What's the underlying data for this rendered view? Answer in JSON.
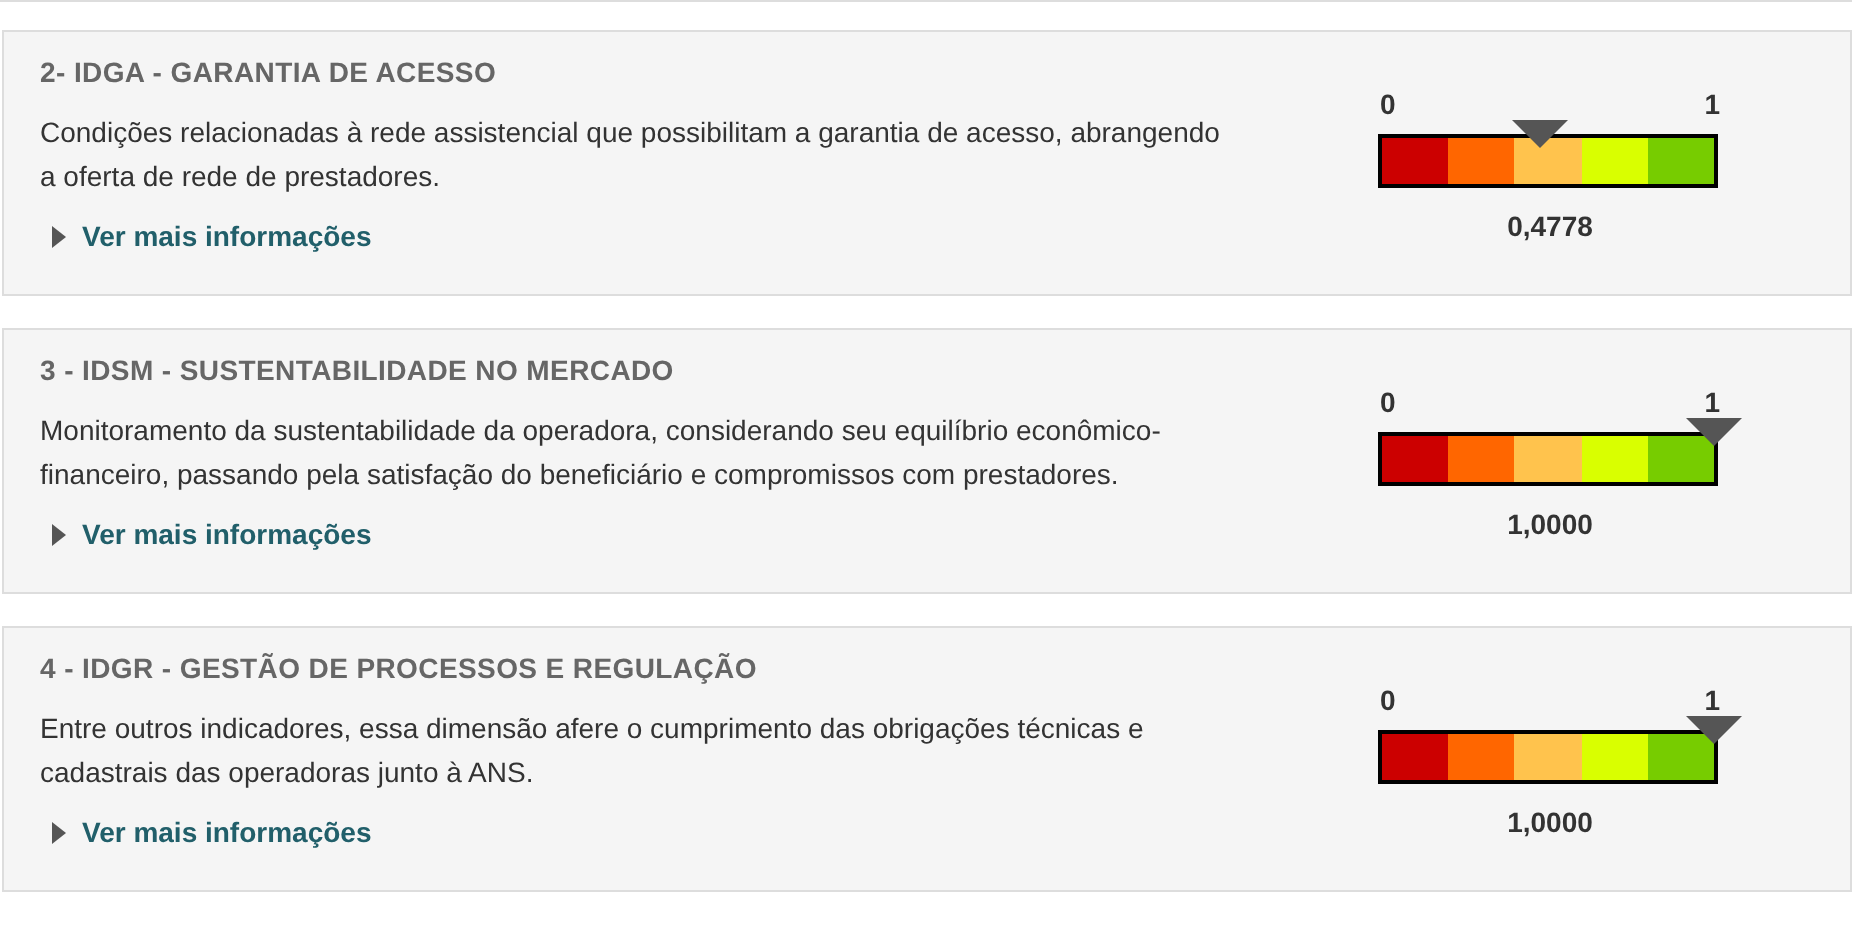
{
  "indicators": [
    {
      "title": "2- IDGA - GARANTIA DE ACESSO",
      "description": "Condições relacionadas à rede assistencial que possibilitam a garantia de acesso, abrangendo a oferta de rede de prestadores.",
      "link": "Ver mais informações",
      "scale_min": "0",
      "scale_max": "1",
      "level": 0.4778,
      "reading": "0,4778"
    },
    {
      "title": "3 - IDSM - SUSTENTABILIDADE NO MERCADO",
      "description": "Monitoramento da sustentabilidade da operadora, considerando seu equilíbrio econômico-financeiro, passando pela satisfação do beneficiário e compromissos com prestadores.",
      "link": "Ver mais informações",
      "scale_min": "0",
      "scale_max": "1",
      "level": 1,
      "reading": "1,0000"
    },
    {
      "title": "4 - IDGR - GESTÃO DE PROCESSOS E REGULAÇÃO",
      "description": "Entre outros indicadores, essa dimensão afere o cumprimento das obrigações técnicas e cadastrais das operadoras junto à ANS.",
      "link": "Ver mais informações",
      "scale_min": "0",
      "scale_max": "1",
      "level": 1,
      "reading": "1,0000"
    }
  ]
}
